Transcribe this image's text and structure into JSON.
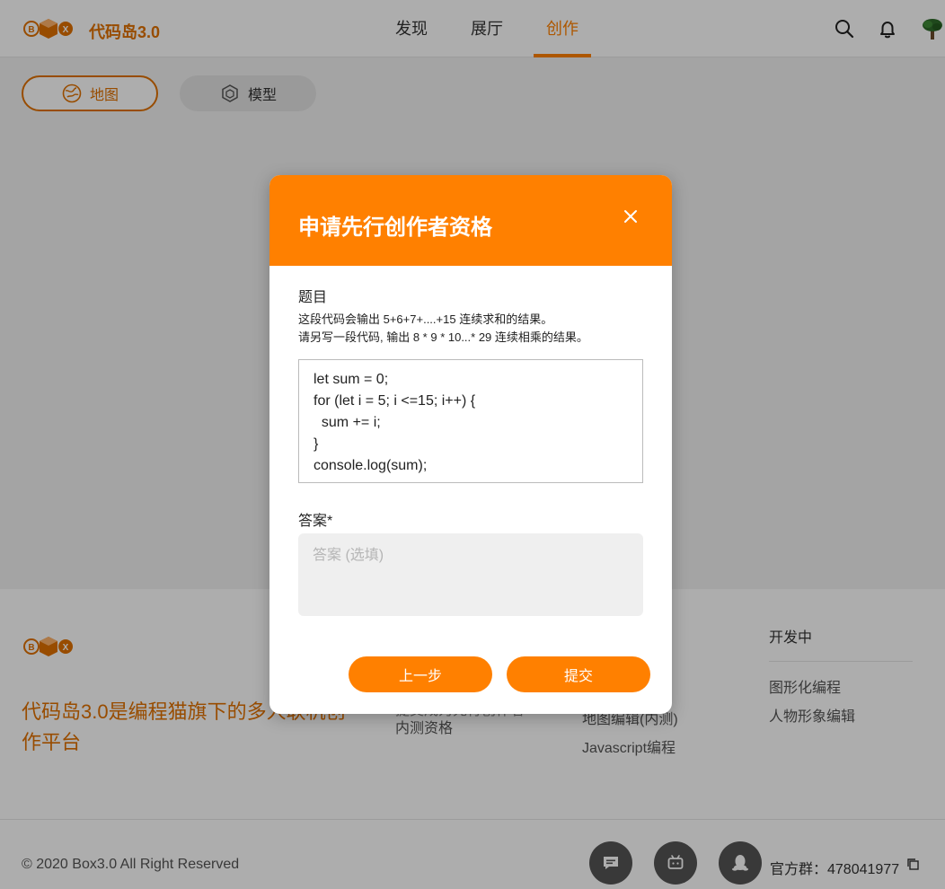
{
  "header": {
    "brand": "代码岛3.0",
    "nav": [
      {
        "label": "发现"
      },
      {
        "label": "展厅"
      },
      {
        "label": "创作"
      }
    ]
  },
  "tabs": {
    "map_label": "地图",
    "model_label": "模型"
  },
  "footer": {
    "slogan": "代码岛3.0是编程猫旗下的多人联机创作平台",
    "col1": {
      "link_partial": "提交成为先行创作者",
      "link2": "内测资格"
    },
    "col2": {
      "links": [
        "地图编辑(内测)",
        "Javascript编程"
      ]
    },
    "col3": {
      "title": "开发中",
      "links": [
        "图形化编程",
        "人物形象编辑"
      ]
    },
    "copyright": "© 2020 Box3.0 All Right Reserved",
    "group_text": "官方群：478041977"
  },
  "modal": {
    "title": "申请先行创作者资格",
    "question_label": "题目",
    "question_line1": "这段代码会输出 5+6+7+....+15 连续求和的结果。",
    "question_line2": "请另写一段代码, 输出 8 * 9 * 10...* 29 连续相乘的结果。",
    "code_lines": [
      "let sum = 0;",
      "for (let i = 5; i <=15; i++) {",
      "  sum += i;",
      "}",
      "console.log(sum);"
    ],
    "answer_label": "答案*",
    "answer_placeholder": "答案 (选填)",
    "answer_value": "",
    "prev_label": "上一步",
    "submit_label": "提交"
  },
  "colors": {
    "accent": "#ff8000",
    "brand_text": "#e07100"
  },
  "icons": [
    "logo-icon",
    "search-icon",
    "bell-icon",
    "avatar",
    "map-icon",
    "model-icon",
    "close-icon",
    "message-icon",
    "tv-icon",
    "qq-icon",
    "copy-icon"
  ]
}
